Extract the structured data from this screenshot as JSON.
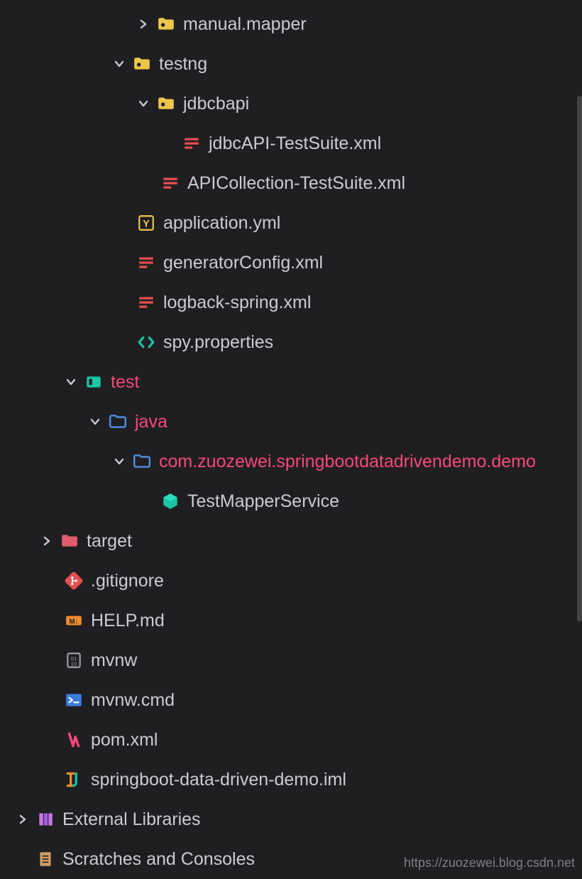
{
  "tree": {
    "manual_mapper": "manual.mapper",
    "testng": "testng",
    "jdbcbapi": "jdbcbapi",
    "jdbc_suite": "jdbcAPI-TestSuite.xml",
    "api_collection": "APICollection-TestSuite.xml",
    "app_yml": "application.yml",
    "gen_config": "generatorConfig.xml",
    "logback": "logback-spring.xml",
    "spy": "spy.properties",
    "test": "test",
    "java": "java",
    "pkg": "com.zuozewei.springbootdatadrivendemo.demo",
    "test_mapper": "TestMapperService",
    "target": "target",
    "gitignore": ".gitignore",
    "help_md": "HELP.md",
    "mvnw": "mvnw",
    "mvnw_cmd": "mvnw.cmd",
    "pom": "pom.xml",
    "iml": "springboot-data-driven-demo.iml",
    "ext_lib": "External Libraries",
    "scratches": "Scratches and Consoles"
  },
  "watermark": "https://zuozewei.blog.csdn.net"
}
